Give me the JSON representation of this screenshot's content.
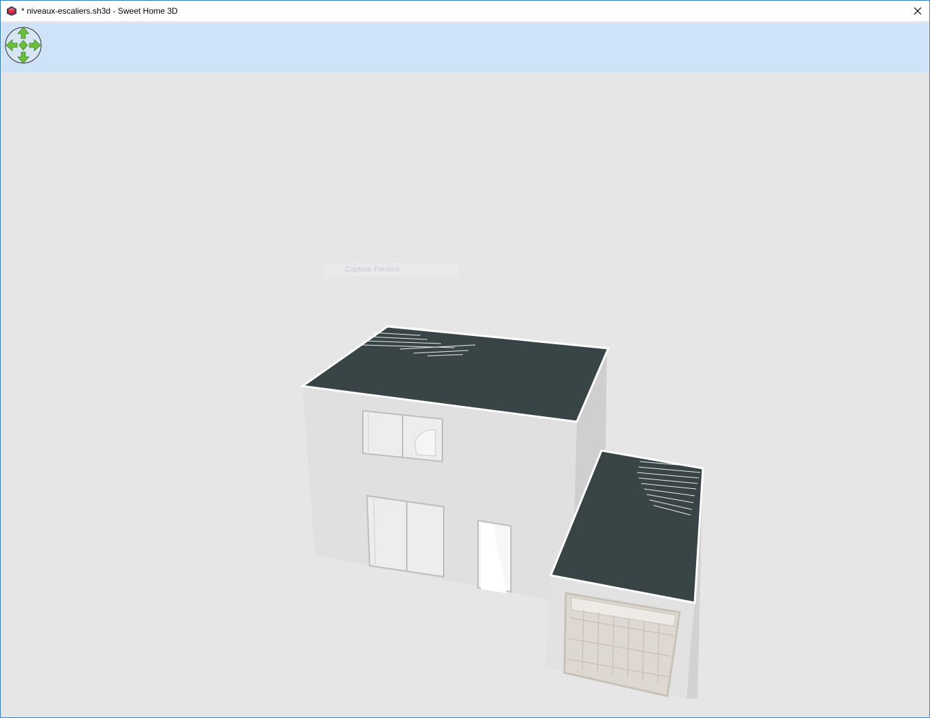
{
  "window": {
    "title": "* niveaux-escaliers.sh3d - Sweet Home 3D",
    "close_glyph": "✕"
  },
  "icons": {
    "app": "sweet-home-3d-app-icon",
    "close": "close-icon",
    "navigator": "navigation-arrows-icon"
  },
  "view3d": {
    "overlay_text": "Capture Fenêtre"
  },
  "colors": {
    "titlebar_bg": "#ffffff",
    "window_border": "#2f7fd6",
    "nav_strip_bg": "#cee2f8",
    "view_bg": "#e6e6e6",
    "roof": "#394447",
    "wall": "#e0e0e0",
    "navigator_green": "#6cc13a"
  }
}
